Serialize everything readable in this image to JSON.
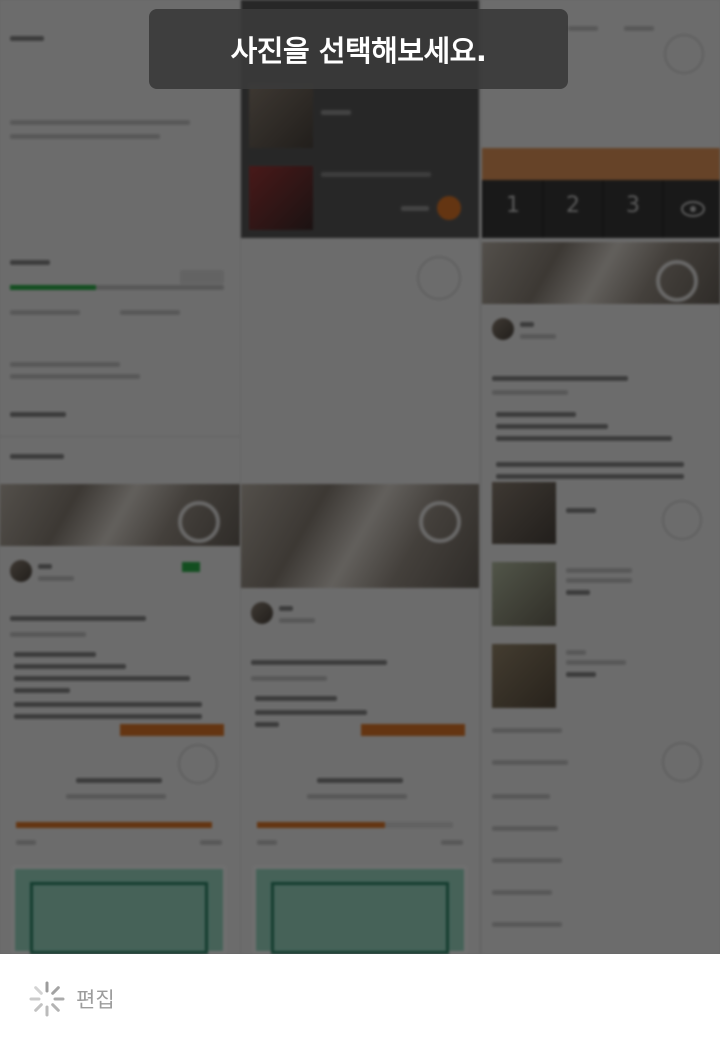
{
  "toast": {
    "message": "사진을 선택해보세요."
  },
  "bottom_bar": {
    "edit_label": "편집",
    "loading_icon": "loading-spinner-icon"
  },
  "collage": {
    "numpad_keys": [
      "1",
      "2",
      "3"
    ],
    "numpad_last_icon": "eye-icon"
  },
  "colors": {
    "overlay": "rgba(0,0,0,0.56)",
    "toast_bg": "#3a3a3a",
    "toast_text": "#ffffff",
    "edit_label": "#9c9c9c",
    "accent_orange": "#e47a2a",
    "accent_green": "#2db24a",
    "floorplan_mint": "#9fe0c9"
  }
}
